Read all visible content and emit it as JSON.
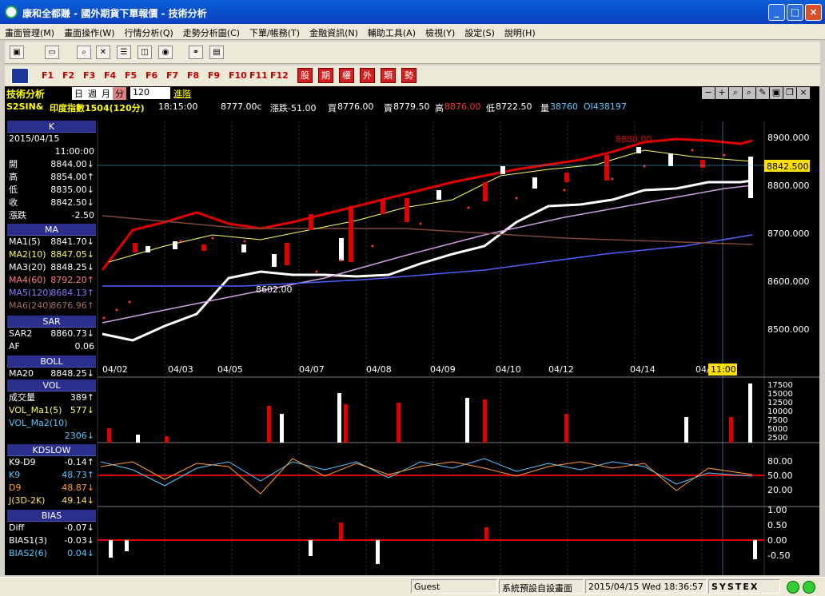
{
  "window": {
    "title": "康和全都賺 - 國外期貨下單報價 - 技術分析",
    "min": "_",
    "max": "□",
    "close": "×"
  },
  "menu": [
    "畫面管理(M)",
    "畫面操作(W)",
    "行情分析(Q)",
    "走勢分析圖(C)",
    "下單/帳務(T)",
    "金融資訊(N)",
    "輔助工具(A)",
    "檢視(Y)",
    "設定(S)",
    "說明(H)"
  ],
  "fkeys": [
    "F1",
    "F2",
    "F3",
    "F4",
    "F5",
    "F6",
    "F7",
    "F8",
    "F9",
    "F10",
    "F11",
    "F12"
  ],
  "redkeys": [
    "股",
    "期",
    "權",
    "外",
    "類",
    "勢"
  ],
  "chart_header": {
    "title": "技術分析",
    "periods": [
      "日",
      "週",
      "月",
      "分"
    ],
    "selected_period": "分",
    "interval": "120",
    "advanced": "進階"
  },
  "quote": {
    "symbol": "S2SIN&",
    "name": "印度指數1504(120分)",
    "time": "18:15:00",
    "last": "8777.00c",
    "change": "漲跌-51.00",
    "bid_label": "買",
    "bid": "8776.00",
    "ask_label": "賣",
    "ask": "8779.50",
    "high_label": "高",
    "high": "8876.00",
    "low_label": "低",
    "low": "8722.50",
    "vol_label": "量",
    "vol": "38760",
    "oi": "OI438197"
  },
  "k_panel": {
    "title": "K",
    "date": "2015/04/15",
    "time": "11:00:00",
    "rows": [
      {
        "k": "開",
        "v": "8844.00↓"
      },
      {
        "k": "高",
        "v": "8854.00↑"
      },
      {
        "k": "低",
        "v": "8835.00↓"
      },
      {
        "k": "收",
        "v": "8842.50↓"
      },
      {
        "k": "漲跌",
        "v": "-2.50"
      }
    ]
  },
  "ma_panel": {
    "title": "MA",
    "rows": [
      {
        "k": "MA1(5)",
        "v": "8841.70↓",
        "c": "#ffffff"
      },
      {
        "k": "MA2(10)",
        "v": "8847.05↓",
        "c": "#ffff60"
      },
      {
        "k": "MA3(20)",
        "v": "8848.25↓",
        "c": "#ffffff"
      },
      {
        "k": "MA4(60)",
        "v": "8792.20↑",
        "c": "#ff8080"
      },
      {
        "k": "MA5(120)",
        "v": "8684.13↑",
        "c": "#8080ff"
      },
      {
        "k": "MA6(240)",
        "v": "8676.96↑",
        "c": "#a07060"
      }
    ]
  },
  "sar_panel": {
    "title": "SAR",
    "rows": [
      {
        "k": "SAR2",
        "v": "8860.73↓"
      },
      {
        "k": "AF",
        "v": "0.06"
      }
    ]
  },
  "boll_panel": {
    "title": "BOLL",
    "rows": [
      {
        "k": "MA20",
        "v": "8848.25↓"
      }
    ]
  },
  "vol_panel": {
    "title": "VOL",
    "rows": [
      {
        "k": "成交量",
        "v": "389↑"
      },
      {
        "k": "VOL_Ma1(5)",
        "v": "577↓"
      },
      {
        "k": "VOL_Ma2(10)",
        "v": ""
      },
      {
        "k": "",
        "v": "2306↓"
      }
    ]
  },
  "kd_panel": {
    "title": "KDSLOW",
    "rows": [
      {
        "k": "K9-D9",
        "v": "-0.14↑"
      },
      {
        "k": "K9",
        "v": "48.73↑"
      },
      {
        "k": "D9",
        "v": "48.87↓"
      },
      {
        "k": "J(3D-2K)",
        "v": "49.14↓"
      }
    ]
  },
  "bias_panel": {
    "title": "BIAS",
    "rows": [
      {
        "k": "Diff",
        "v": "-0.07↓"
      },
      {
        "k": "BIAS1(3)",
        "v": "-0.03↓"
      },
      {
        "k": "BIAS2(6)",
        "v": "0.04↓"
      }
    ]
  },
  "price_axis": [
    "8900.000",
    "8800.000",
    "8700.000",
    "8600.000",
    "8500.000"
  ],
  "price_marker": "8842.500",
  "annotations": {
    "high": "8880.00",
    "low": "8602.00"
  },
  "x_dates": [
    "04/02",
    "04/03",
    "04/05",
    "04/07",
    "04/08",
    "04/09",
    "04/10",
    "04/12",
    "04/14",
    "04/",
    "11:00"
  ],
  "vol_axis": [
    "17500",
    "15000",
    "12500",
    "10000",
    "7500",
    "5000",
    "2500"
  ],
  "kd_axis": [
    "80.00",
    "50.00",
    "20.00"
  ],
  "bias_axis": [
    "1.00",
    "0.50",
    "0.00",
    "-0.50"
  ],
  "chart_data": {
    "type": "candlestick",
    "price_ticks": [
      8900,
      8800,
      8700,
      8600,
      8500
    ],
    "last_close": 8842.5,
    "high_label": 8880,
    "low_label": 8602
  },
  "status": {
    "user": "Guest",
    "layout": "系統預設自設畫面",
    "datetime": "2015/04/15 Wed 18:36:57",
    "brand": "SYSTEX"
  }
}
